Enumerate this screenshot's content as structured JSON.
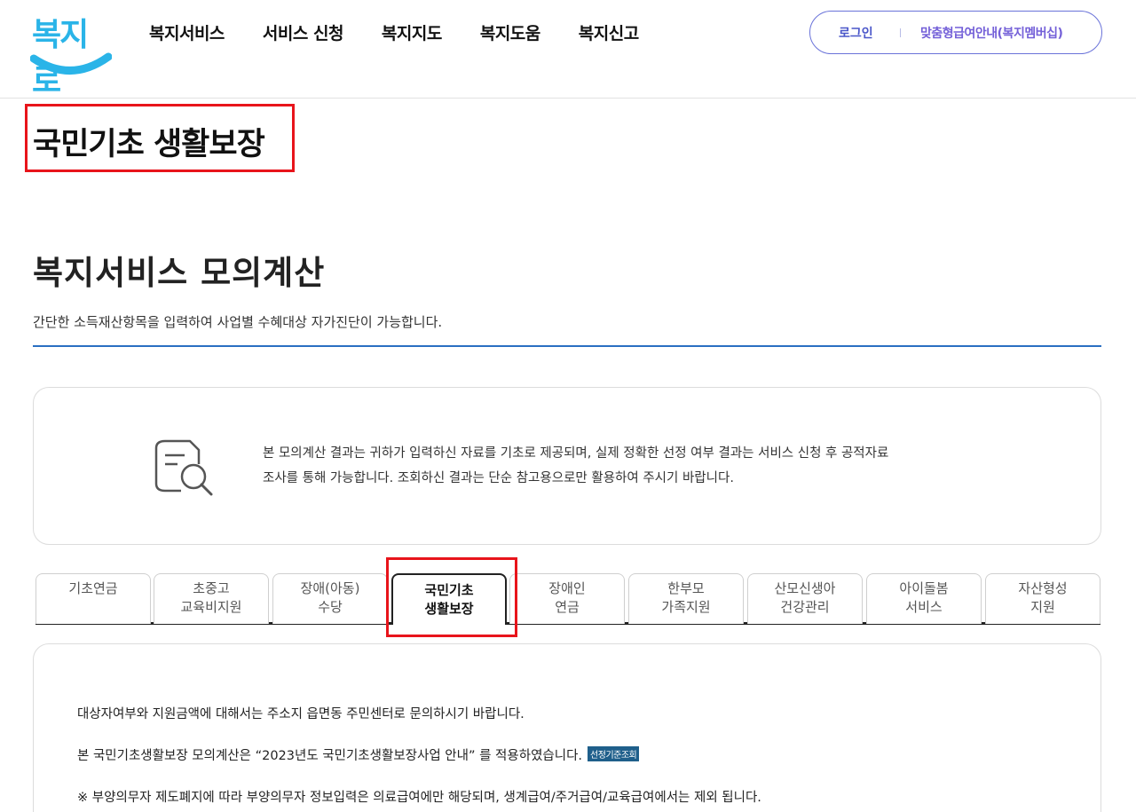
{
  "header": {
    "logo_text": "복지로",
    "nav": [
      "복지서비스",
      "서비스 신청",
      "복지지도",
      "복지도움",
      "복지신고"
    ],
    "login_label": "로그인",
    "member_label": "맞춤형급여안내(복지멤버십)"
  },
  "page_title": "국민기초 생활보장",
  "section": {
    "title": "복지서비스 모의계산",
    "description": "간단한 소득재산항목을 입력하여 사업별 수혜대상 자가진단이 가능합니다."
  },
  "notice": {
    "icon": "document-search-icon",
    "line1": "본 모의계산 결과는 귀하가 입력하신 자료를 기초로 제공되며, 실제 정확한 선정 여부 결과는 서비스 신청 후 공적자료",
    "line2": "조사를 통해 가능합니다. 조회하신 결과는 단순 참고용으로만 활용하여 주시기 바랍니다."
  },
  "tabs": [
    {
      "line1": "기초연금",
      "line2": ""
    },
    {
      "line1": "초중고",
      "line2": "교육비지원"
    },
    {
      "line1": "장애(아동)",
      "line2": "수당"
    },
    {
      "line1": "국민기초",
      "line2": "생활보장"
    },
    {
      "line1": "장애인",
      "line2": "연금"
    },
    {
      "line1": "한부모",
      "line2": "가족지원"
    },
    {
      "line1": "산모신생아",
      "line2": "건강관리"
    },
    {
      "line1": "아이돌봄",
      "line2": "서비스"
    },
    {
      "line1": "자산형성",
      "line2": "지원"
    }
  ],
  "active_tab_index": 3,
  "content": {
    "line1": "대상자여부와 지원금액에 대해서는 주소지 읍면동 주민센터로 문의하시기 바랍니다.",
    "line2": "본 국민기초생활보장 모의계산은 “2023년도 국민기초생활보장사업 안내” 를 적용하였습니다.",
    "badge": "선정기준조회",
    "line3": "※ 부양의무자 제도폐지에 따라 부양의무자 정보입력은 의료급여에만 해당되며, 생계급여/주거급여/교육급여에서는 제외 됩니다."
  },
  "colors": {
    "highlight": "#e8141b",
    "brand_blue": "#2ab4e8",
    "accent_rule": "#2a6fc2",
    "login_text": "#4a56c9"
  }
}
